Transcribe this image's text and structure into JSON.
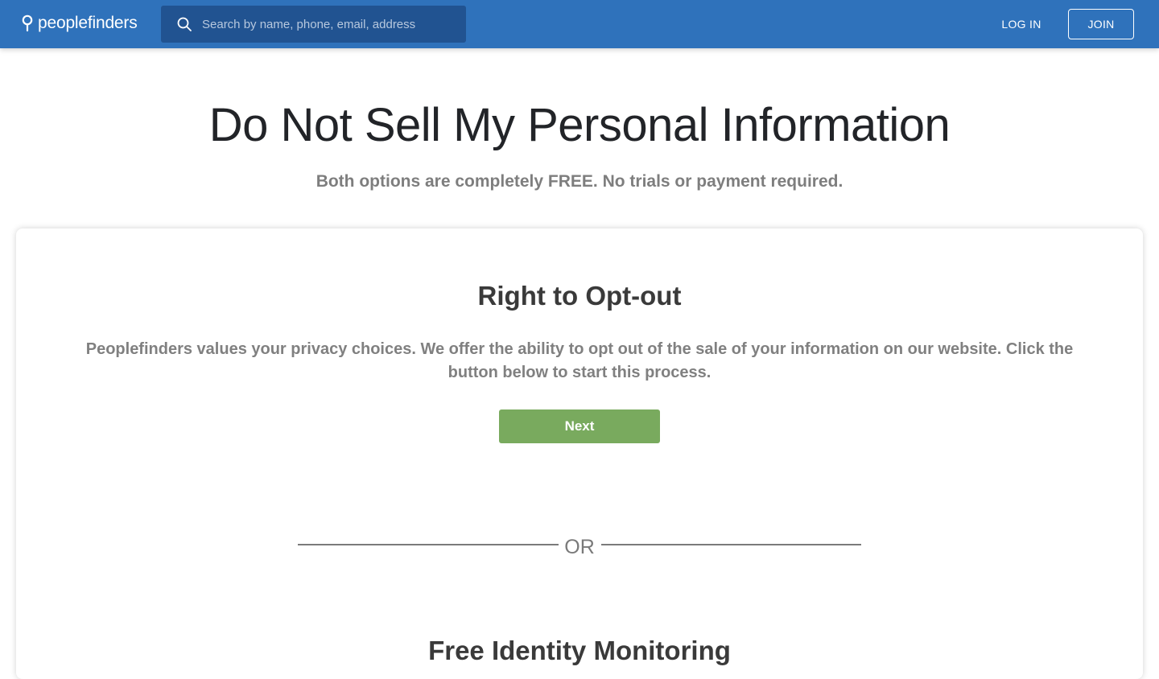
{
  "header": {
    "logo_text": "peoplefinders",
    "search_placeholder": "Search by name, phone, email, address",
    "login_label": "LOG IN",
    "join_label": "JOIN",
    "bg_color": "#2f72bb"
  },
  "hero": {
    "title": "Do Not Sell My Personal Information",
    "subtitle": "Both options are completely FREE. No trials or payment required."
  },
  "opt_out": {
    "title": "Right to Opt-out",
    "description": "Peoplefinders values your privacy choices. We offer the ability to opt out of the sale of your information on our website. Click the button below to start this process.",
    "button_label": "Next",
    "button_color": "#79aa5e"
  },
  "divider": {
    "label": "OR"
  },
  "identity": {
    "title": "Free Identity Monitoring"
  },
  "icons": {
    "logo": "location-pin-icon",
    "search": "search-icon"
  }
}
